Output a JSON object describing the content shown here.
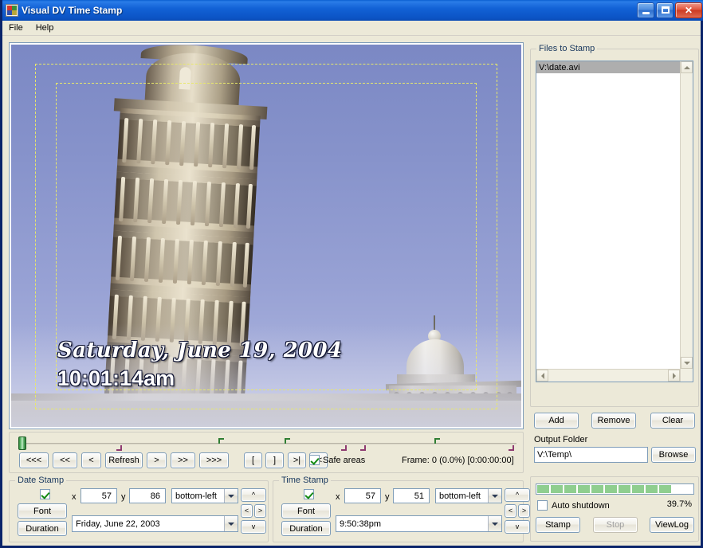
{
  "window": {
    "title": "Visual DV Time Stamp",
    "icon": "app-icon",
    "buttons": {
      "minimize": "minimize",
      "maximize": "maximize",
      "close": "close"
    }
  },
  "menu": {
    "items": [
      "File",
      "Help"
    ]
  },
  "preview": {
    "scene": "leaning-tower-of-pisa",
    "safe_areas_visible": true,
    "overlay": {
      "date_text": "Saturday, June 19, 2004",
      "time_text": "10:01:14am"
    }
  },
  "transport": {
    "buttons": [
      "<<<",
      "<<",
      "<",
      "Refresh",
      ">",
      ">>",
      ">>>",
      "[",
      "]",
      ">|",
      "|<"
    ],
    "safe_areas_label": "Safe areas",
    "safe_areas_checked": true,
    "frame_label": "Frame: 0 (0.0%) [0:00:00:00]",
    "slider_position_pct": 0,
    "markers_in_pct": [
      39.0,
      60.5
    ],
    "markers_out_pct": [
      18.5,
      54.0,
      58.5,
      99.5
    ],
    "marker_mid_pct": 80.0
  },
  "date_stamp": {
    "legend": "Date Stamp",
    "enabled": true,
    "font_label": "Font",
    "duration_label": "Duration",
    "x_label": "x",
    "x_value": "57",
    "y_label": "y",
    "y_value": "86",
    "anchor": "bottom-left",
    "value": "Friday, June 22, 2003",
    "nav": {
      "up": "^",
      "left": "<",
      "right": ">",
      "down": "v"
    }
  },
  "time_stamp": {
    "legend": "Time Stamp",
    "enabled": true,
    "font_label": "Font",
    "duration_label": "Duration",
    "x_label": "x",
    "x_value": "57",
    "y_label": "y",
    "y_value": "51",
    "anchor": "bottom-left",
    "value": "9:50:38pm",
    "nav": {
      "up": "^",
      "left": "<",
      "right": ">",
      "down": "v"
    }
  },
  "files": {
    "legend": "Files to Stamp",
    "items": [
      "V:\\date.avi"
    ],
    "selected_index": 0,
    "add_label": "Add",
    "remove_label": "Remove",
    "clear_label": "Clear"
  },
  "output": {
    "label": "Output Folder",
    "path": "V:\\Temp\\",
    "browse_label": "Browse"
  },
  "run": {
    "progress_pct": "39.7%",
    "progress_value": 39.7,
    "progress_segments": 10,
    "auto_shutdown_label": "Auto shutdown",
    "auto_shutdown_checked": false,
    "stamp_label": "Stamp",
    "stop_label": "Stop",
    "stop_disabled": true,
    "viewlog_label": "ViewLog"
  },
  "colors": {
    "titlebar": "#0b53c4",
    "face": "#ece9d8",
    "group_legend": "#17365d",
    "progress_fill": "#8fce8f",
    "safe_area": "#e8e86a",
    "selection": "#aeaeae"
  }
}
